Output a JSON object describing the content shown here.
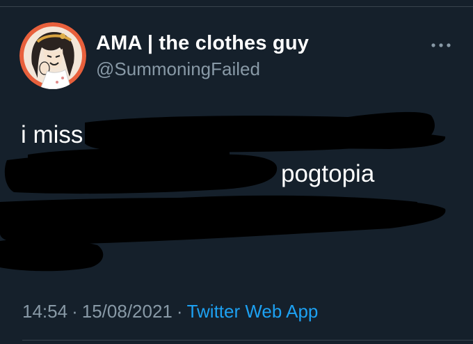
{
  "tweet": {
    "author": {
      "display_name": "AMA | the clothes guy",
      "handle": "@SummoningFailed",
      "avatar_icon": "anime-character-avatar"
    },
    "text_visible": {
      "line1": "i miss",
      "line2": "pogtopia"
    },
    "redacted": true,
    "meta": {
      "time": "14:54",
      "separator": "·",
      "date": "15/08/2021",
      "source": "Twitter Web App"
    },
    "menu_icon": "more-horizontal-icon"
  },
  "colors": {
    "background": "#15202b",
    "text_primary": "#ffffff",
    "text_secondary": "#8899a6",
    "accent": "#1da1f2",
    "divider": "#38444d",
    "redaction": "#000000"
  }
}
